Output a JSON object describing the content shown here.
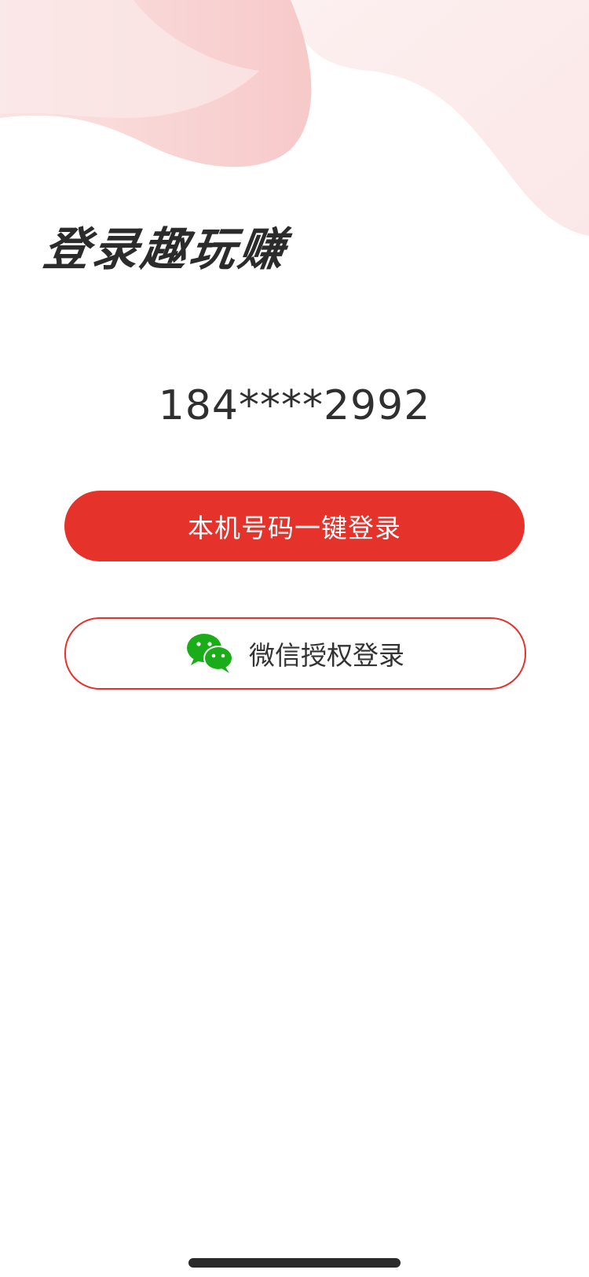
{
  "header": {
    "title": "登录趣玩赚"
  },
  "account": {
    "masked_phone": "184****2992"
  },
  "actions": {
    "one_click_login_label": "本机号码一键登录",
    "wechat_login_label": "微信授权登录"
  },
  "icons": {
    "wechat": "wechat-icon"
  },
  "colors": {
    "primary": "#e5322b",
    "wechat_green": "#1aad19",
    "title_text": "#2b2b2b"
  }
}
